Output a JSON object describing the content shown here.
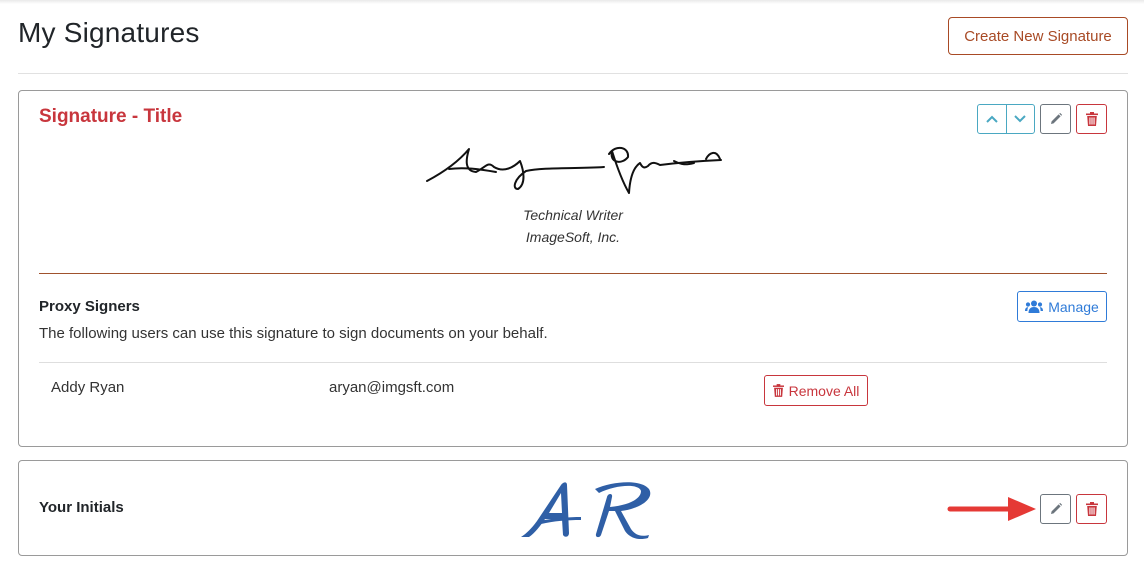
{
  "header": {
    "title": "My Signatures",
    "create_label": "Create New Signature"
  },
  "signature_card": {
    "title": "Signature - Title",
    "signature_image": "handwritten-signature-addy-ryan",
    "job_title": "Technical Writer",
    "company": "ImageSoft, Inc.",
    "icons": {
      "move_up": "chevron-up-icon",
      "move_down": "chevron-down-icon",
      "edit": "pencil-icon",
      "delete": "trash-icon"
    }
  },
  "proxy": {
    "heading": "Proxy Signers",
    "description": "The following users can use this signature to sign documents on your behalf.",
    "manage_label": "Manage",
    "manage_icon": "users-icon",
    "signers": [
      {
        "name": "Addy Ryan",
        "email": "aryan@imgsft.com"
      }
    ],
    "remove_all_label": "Remove All",
    "remove_icon": "trash-icon"
  },
  "initials_card": {
    "label": "Your Initials",
    "initials_image": "initials-ar",
    "icons": {
      "edit": "pencil-icon",
      "delete": "trash-icon"
    }
  },
  "annotation": {
    "arrow": "red-arrow-pointing-to-edit-initials"
  },
  "colors": {
    "brand": "#a84a25",
    "title_red": "#c8363d",
    "info": "#4aa8c2",
    "primary": "#2f7bd8",
    "initials_blue": "#2f5fa6",
    "arrow_red": "#e53935"
  }
}
